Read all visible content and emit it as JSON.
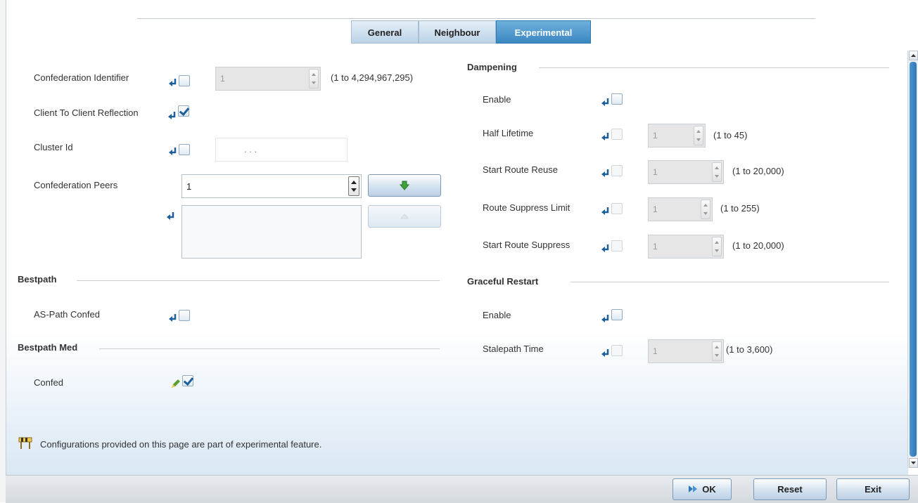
{
  "tabs": [
    {
      "label": "General",
      "active": false
    },
    {
      "label": "Neighbour",
      "active": false
    },
    {
      "label": "Experimental",
      "active": true
    }
  ],
  "left": {
    "confederation_identifier": {
      "label": "Confederation Identifier",
      "value": "1",
      "range": "(1 to 4,294,967,295)",
      "checked": false
    },
    "client_to_client_reflection": {
      "label": "Client To Client Reflection",
      "checked": true
    },
    "cluster_id": {
      "label": "Cluster Id",
      "value": ".      .      .",
      "checked": false
    },
    "confederation_peers": {
      "label": "Confederation Peers",
      "value": "1",
      "add_icon": "green-down-arrow-icon",
      "remove_icon": "up-arrow-icon"
    },
    "bestpath": {
      "title": "Bestpath",
      "as_path_confed_label": "AS-Path Confed",
      "as_path_confed_checked": false
    },
    "bestpath_med": {
      "title": "Bestpath Med",
      "confed_label": "Confed",
      "confed_checked": true
    },
    "note": "Configurations provided on this page are part of experimental feature."
  },
  "dampening": {
    "title": "Dampening",
    "enable_label": "Enable",
    "enable_checked": false,
    "half_lifetime": {
      "label": "Half Lifetime",
      "value": "1",
      "range": "(1 to 45)"
    },
    "start_route_reuse": {
      "label": "Start Route Reuse",
      "value": "1",
      "range": "(1 to 20,000)"
    },
    "route_suppress_limit": {
      "label": "Route Suppress Limit",
      "value": "1",
      "range": "(1 to 255)"
    },
    "start_route_suppress": {
      "label": "Start Route Suppress",
      "value": "1",
      "range": "(1 to 20,000)"
    }
  },
  "graceful_restart": {
    "title": "Graceful Restart",
    "enable_label": "Enable",
    "enable_checked": false,
    "stalepath_time": {
      "label": "Stalepath Time",
      "value": "1",
      "range": "(1 to 3,600)"
    }
  },
  "footer": {
    "ok": "OK",
    "reset": "Reset",
    "exit": "Exit"
  },
  "colors": {
    "accent": "#3a87c2",
    "pin_blue": "#1d5f9a",
    "pencil_green": "#5aa02c"
  }
}
